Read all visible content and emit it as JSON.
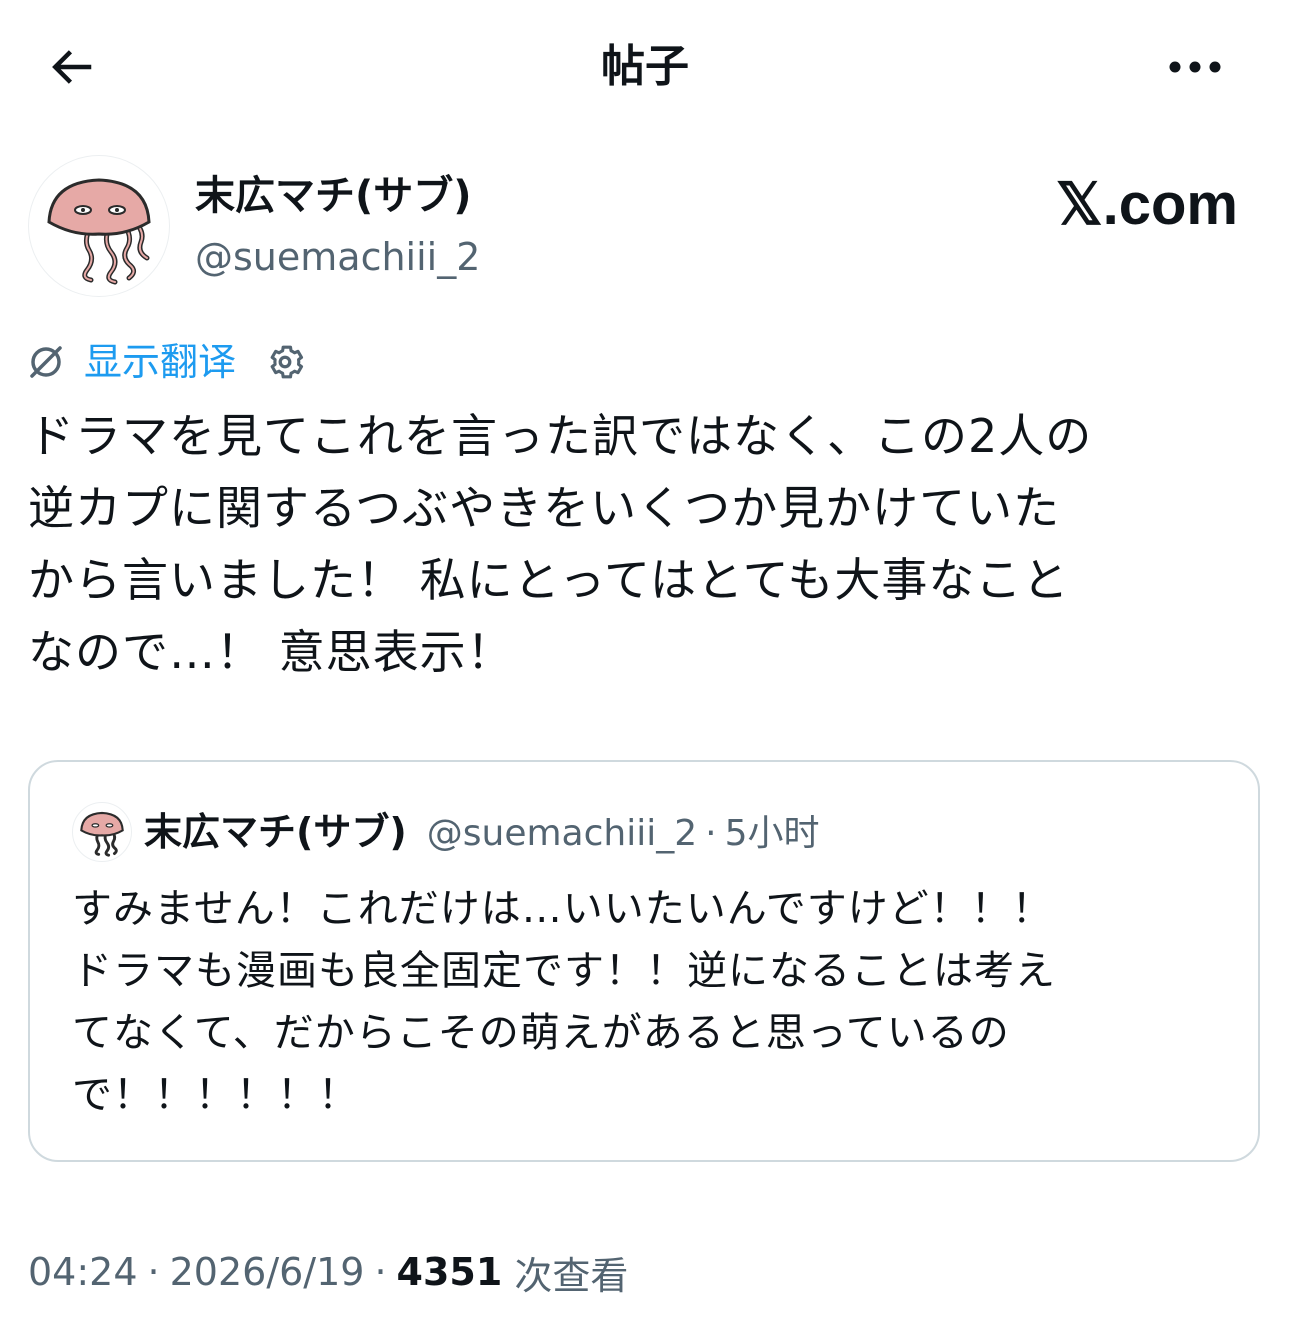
{
  "header": {
    "title": "帖子"
  },
  "post": {
    "author": {
      "display_name": "末広マチ(サブ)",
      "handle": "@suemachiii_2"
    },
    "watermark": "𝕏.com",
    "translate_label": "显示翻译",
    "text_lines": [
      "ドラマを見てこれを言った訳ではなく、この2人の",
      "逆カプに関するつぶやきをいくつか見かけていた",
      "から言いました！ 私にとってはとても大事なこと",
      "なので…！ 意思表示！"
    ],
    "quoted": {
      "display_name": "末広マチ(サブ)",
      "handle": "@suemachiii_2",
      "separator": "·",
      "time": "5小时",
      "text_lines": [
        "すみません！これだけは…いいたいんですけど！！！",
        "ドラマも漫画も良全固定です！！逆になることは考え",
        "てなくて、だからこその萌えがあると思っているの",
        "で！！！！！！"
      ]
    },
    "meta": {
      "time": "04:24",
      "sep1": "·",
      "date": "2026/6/19",
      "sep2": "·",
      "views_count": "4351",
      "views_label": "次查看"
    }
  },
  "icons": {
    "back": "arrow-left-icon",
    "more": "more-horizontal-icon",
    "translate": "translate-icon",
    "settings": "gear-icon"
  },
  "colors": {
    "text": "#0f1419",
    "secondary": "#536471",
    "link": "#1d9bf0",
    "border": "#cfd9de"
  }
}
